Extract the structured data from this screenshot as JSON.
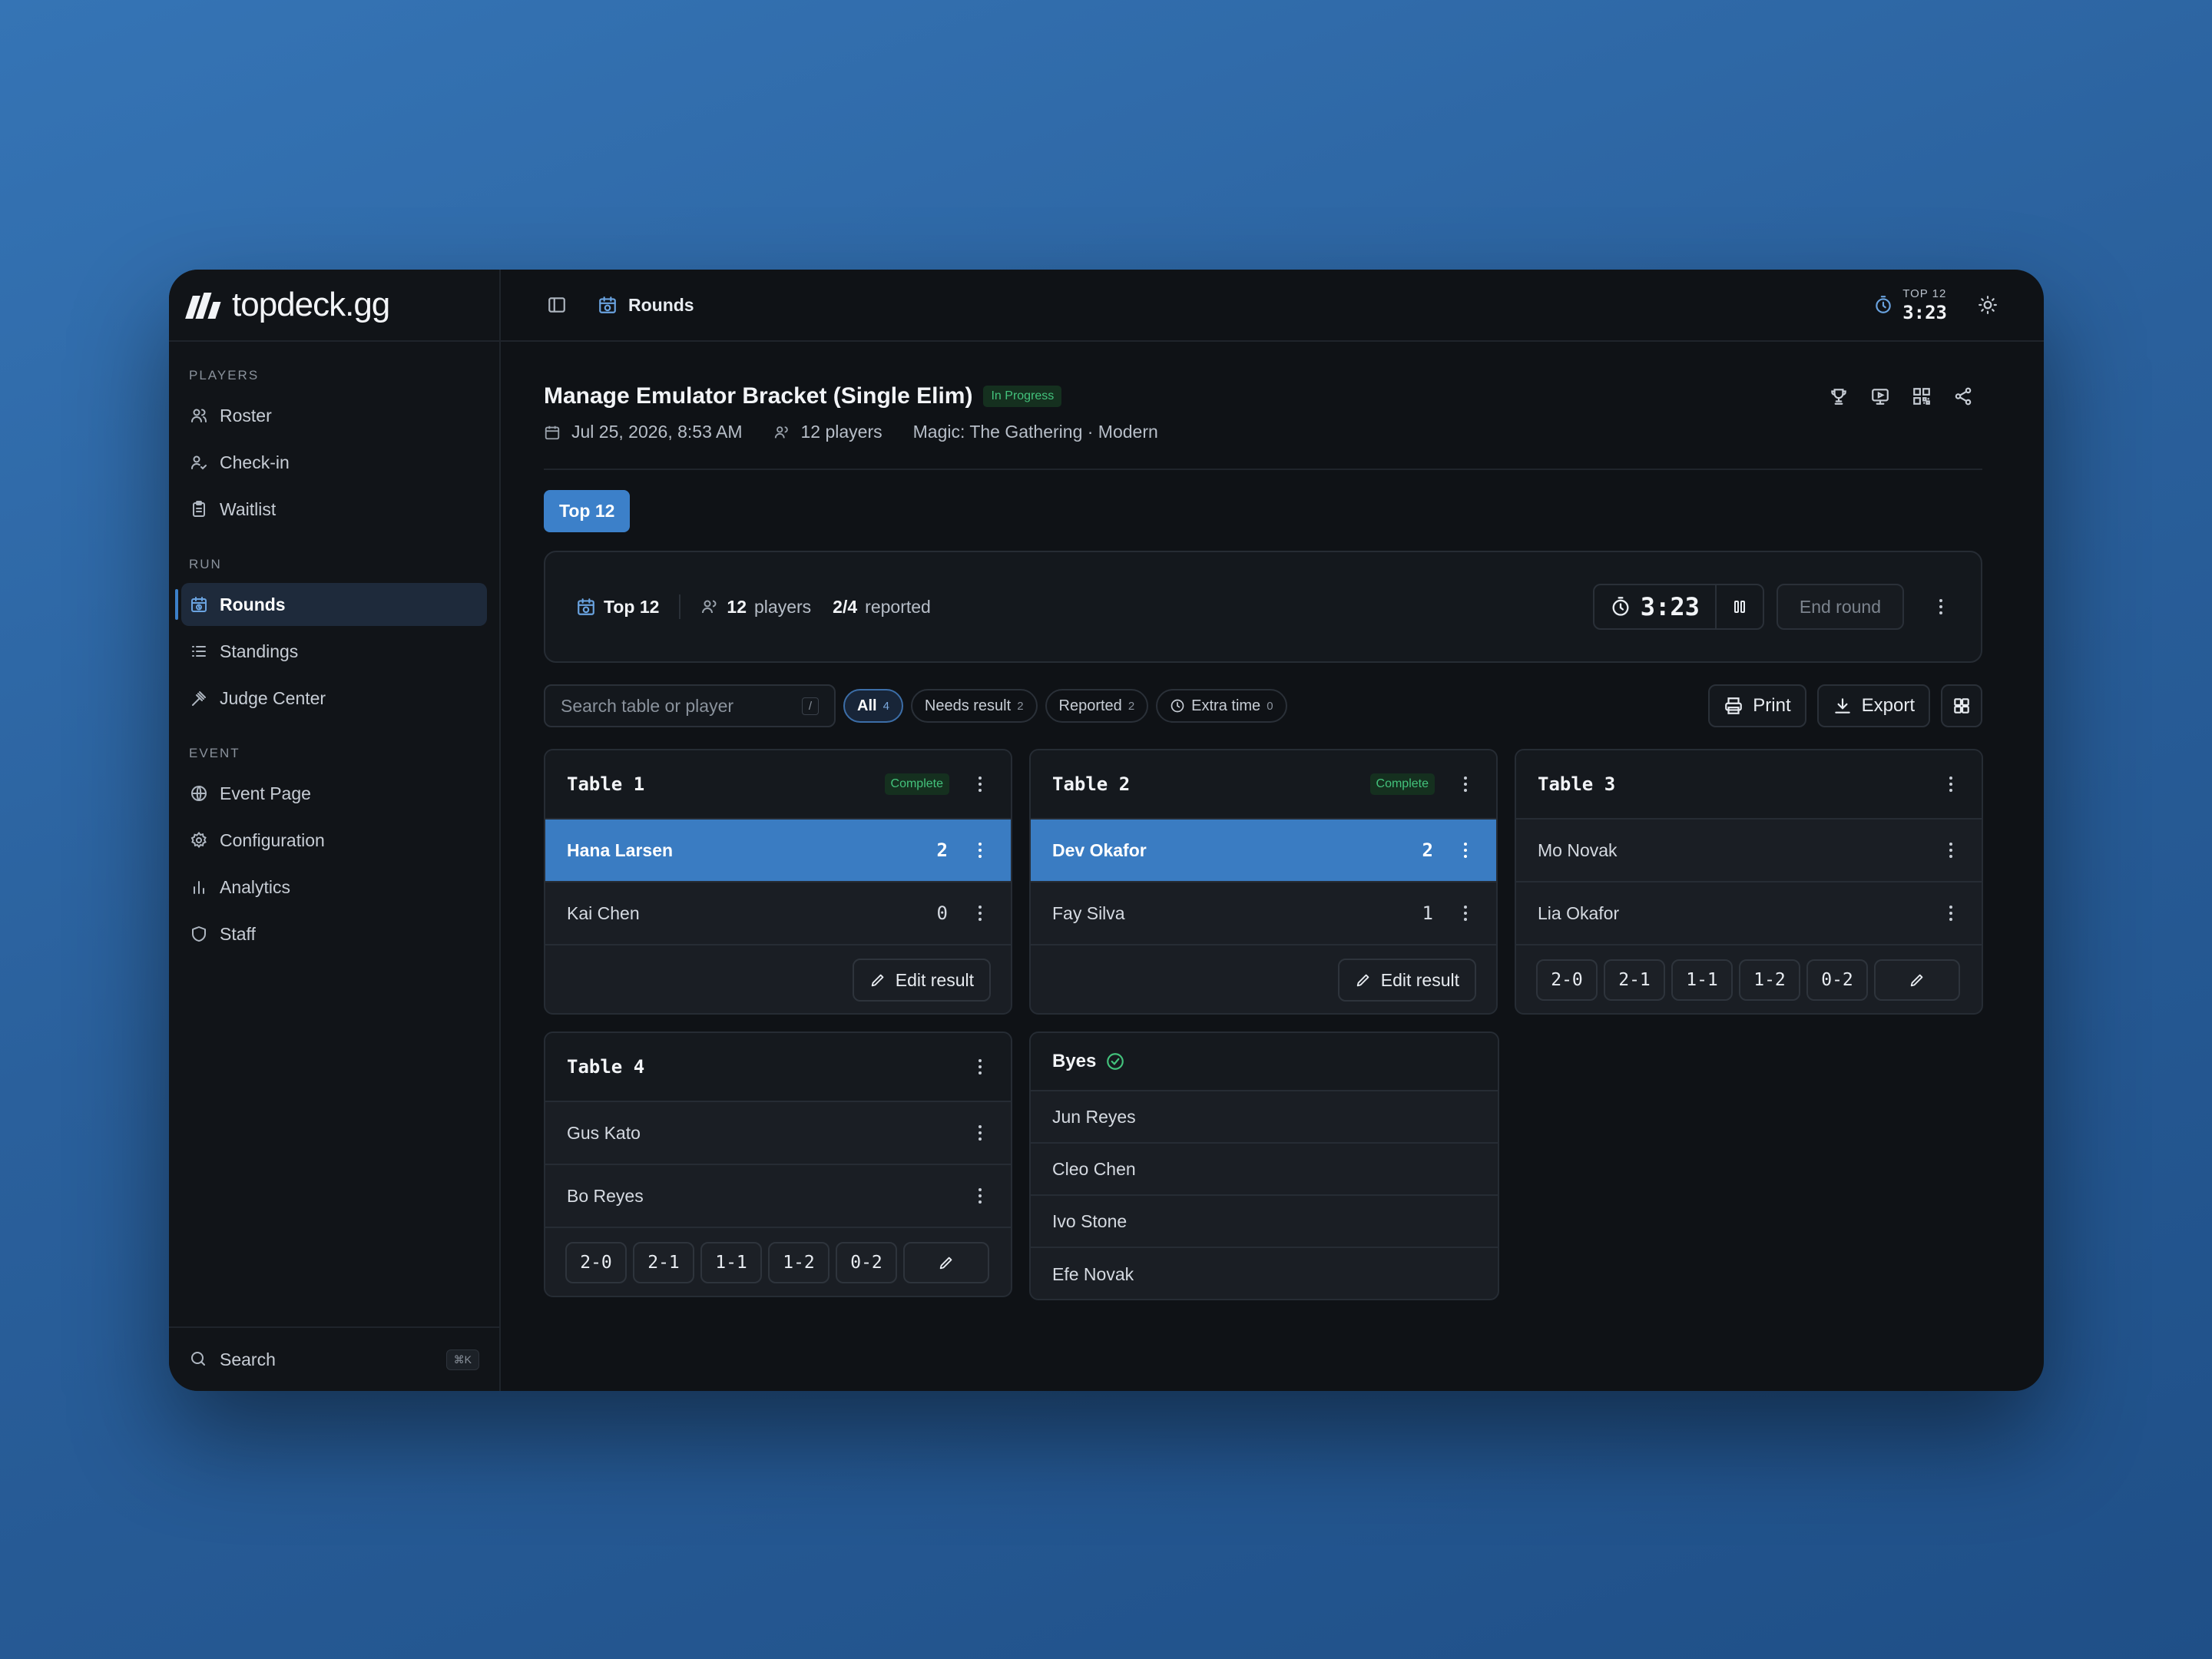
{
  "app": {
    "logo_text": "topdeck.gg"
  },
  "sidebar": {
    "sections": [
      {
        "heading": "PLAYERS",
        "items": [
          {
            "label": "Roster",
            "icon": "users-icon"
          },
          {
            "label": "Check-in",
            "icon": "user-check-icon"
          },
          {
            "label": "Waitlist",
            "icon": "clipboard-icon"
          }
        ]
      },
      {
        "heading": "RUN",
        "items": [
          {
            "label": "Rounds",
            "icon": "calendar-clock-icon",
            "active": true
          },
          {
            "label": "Standings",
            "icon": "list-icon"
          },
          {
            "label": "Judge Center",
            "icon": "gavel-icon"
          }
        ]
      },
      {
        "heading": "EVENT",
        "items": [
          {
            "label": "Event Page",
            "icon": "globe-icon"
          },
          {
            "label": "Configuration",
            "icon": "gear-icon"
          },
          {
            "label": "Analytics",
            "icon": "bar-chart-icon"
          },
          {
            "label": "Staff",
            "icon": "shield-icon"
          }
        ]
      }
    ],
    "search": {
      "label": "Search",
      "shortcut": "⌘K"
    }
  },
  "topbar": {
    "breadcrumb": "Rounds",
    "timer_label": "TOP 12",
    "timer_value": "3:23"
  },
  "event": {
    "title": "Manage Emulator Bracket (Single Elim)",
    "status": "In Progress",
    "date": "Jul 25, 2026, 8:53 AM",
    "players": "12 players",
    "format": "Magic: The Gathering · Modern"
  },
  "round_tab": "Top 12",
  "round": {
    "name": "Top 12",
    "players_count": "12",
    "players_label": "players",
    "reported_count": "2/4",
    "reported_label": "reported",
    "timer": "3:23",
    "end_round_label": "End round"
  },
  "filters": {
    "search_placeholder": "Search table or player",
    "search_shortcut": "/",
    "chips": [
      {
        "label": "All",
        "count": "4",
        "active": true
      },
      {
        "label": "Needs result",
        "count": "2"
      },
      {
        "label": "Reported",
        "count": "2"
      },
      {
        "label": "Extra time",
        "count": "0"
      }
    ],
    "print_label": "Print",
    "export_label": "Export"
  },
  "tables": [
    {
      "name": "Table 1",
      "status": "Complete",
      "players": [
        {
          "name": "Hana Larsen",
          "score": "2",
          "winner": true
        },
        {
          "name": "Kai Chen",
          "score": "0"
        }
      ],
      "edit_label": "Edit result"
    },
    {
      "name": "Table 2",
      "status": "Complete",
      "players": [
        {
          "name": "Dev Okafor",
          "score": "2",
          "winner": true
        },
        {
          "name": "Fay Silva",
          "score": "1"
        }
      ],
      "edit_label": "Edit result"
    },
    {
      "name": "Table 3",
      "players": [
        {
          "name": "Mo Novak"
        },
        {
          "name": "Lia Okafor"
        }
      ],
      "quick_results": [
        "2-0",
        "2-1",
        "1-1",
        "1-2",
        "0-2"
      ]
    },
    {
      "name": "Table 4",
      "players": [
        {
          "name": "Gus Kato"
        },
        {
          "name": "Bo Reyes"
        }
      ],
      "quick_results": [
        "2-0",
        "2-1",
        "1-1",
        "1-2",
        "0-2"
      ]
    }
  ],
  "byes": {
    "title": "Byes",
    "players": [
      "Jun Reyes",
      "Cleo Chen",
      "Ivo Stone",
      "Efe Novak"
    ]
  },
  "colors": {
    "accent": "#3c80c9",
    "winner_row": "#3a7cc2",
    "complete_green": "#43c27c",
    "background": "#0f1216"
  }
}
